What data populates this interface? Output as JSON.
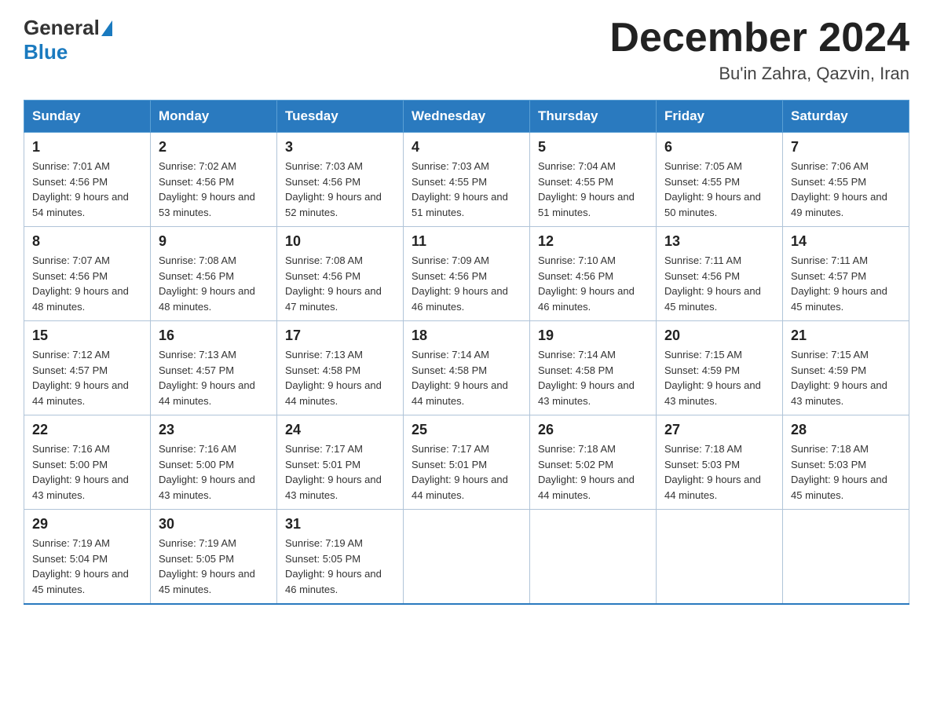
{
  "header": {
    "logo_general": "General",
    "logo_blue": "Blue",
    "month_title": "December 2024",
    "location": "Bu'in Zahra, Qazvin, Iran"
  },
  "days_of_week": [
    "Sunday",
    "Monday",
    "Tuesday",
    "Wednesday",
    "Thursday",
    "Friday",
    "Saturday"
  ],
  "weeks": [
    [
      {
        "day": 1,
        "sunrise": "7:01 AM",
        "sunset": "4:56 PM",
        "daylight": "9 hours and 54 minutes."
      },
      {
        "day": 2,
        "sunrise": "7:02 AM",
        "sunset": "4:56 PM",
        "daylight": "9 hours and 53 minutes."
      },
      {
        "day": 3,
        "sunrise": "7:03 AM",
        "sunset": "4:56 PM",
        "daylight": "9 hours and 52 minutes."
      },
      {
        "day": 4,
        "sunrise": "7:03 AM",
        "sunset": "4:55 PM",
        "daylight": "9 hours and 51 minutes."
      },
      {
        "day": 5,
        "sunrise": "7:04 AM",
        "sunset": "4:55 PM",
        "daylight": "9 hours and 51 minutes."
      },
      {
        "day": 6,
        "sunrise": "7:05 AM",
        "sunset": "4:55 PM",
        "daylight": "9 hours and 50 minutes."
      },
      {
        "day": 7,
        "sunrise": "7:06 AM",
        "sunset": "4:55 PM",
        "daylight": "9 hours and 49 minutes."
      }
    ],
    [
      {
        "day": 8,
        "sunrise": "7:07 AM",
        "sunset": "4:56 PM",
        "daylight": "9 hours and 48 minutes."
      },
      {
        "day": 9,
        "sunrise": "7:08 AM",
        "sunset": "4:56 PM",
        "daylight": "9 hours and 48 minutes."
      },
      {
        "day": 10,
        "sunrise": "7:08 AM",
        "sunset": "4:56 PM",
        "daylight": "9 hours and 47 minutes."
      },
      {
        "day": 11,
        "sunrise": "7:09 AM",
        "sunset": "4:56 PM",
        "daylight": "9 hours and 46 minutes."
      },
      {
        "day": 12,
        "sunrise": "7:10 AM",
        "sunset": "4:56 PM",
        "daylight": "9 hours and 46 minutes."
      },
      {
        "day": 13,
        "sunrise": "7:11 AM",
        "sunset": "4:56 PM",
        "daylight": "9 hours and 45 minutes."
      },
      {
        "day": 14,
        "sunrise": "7:11 AM",
        "sunset": "4:57 PM",
        "daylight": "9 hours and 45 minutes."
      }
    ],
    [
      {
        "day": 15,
        "sunrise": "7:12 AM",
        "sunset": "4:57 PM",
        "daylight": "9 hours and 44 minutes."
      },
      {
        "day": 16,
        "sunrise": "7:13 AM",
        "sunset": "4:57 PM",
        "daylight": "9 hours and 44 minutes."
      },
      {
        "day": 17,
        "sunrise": "7:13 AM",
        "sunset": "4:58 PM",
        "daylight": "9 hours and 44 minutes."
      },
      {
        "day": 18,
        "sunrise": "7:14 AM",
        "sunset": "4:58 PM",
        "daylight": "9 hours and 44 minutes."
      },
      {
        "day": 19,
        "sunrise": "7:14 AM",
        "sunset": "4:58 PM",
        "daylight": "9 hours and 43 minutes."
      },
      {
        "day": 20,
        "sunrise": "7:15 AM",
        "sunset": "4:59 PM",
        "daylight": "9 hours and 43 minutes."
      },
      {
        "day": 21,
        "sunrise": "7:15 AM",
        "sunset": "4:59 PM",
        "daylight": "9 hours and 43 minutes."
      }
    ],
    [
      {
        "day": 22,
        "sunrise": "7:16 AM",
        "sunset": "5:00 PM",
        "daylight": "9 hours and 43 minutes."
      },
      {
        "day": 23,
        "sunrise": "7:16 AM",
        "sunset": "5:00 PM",
        "daylight": "9 hours and 43 minutes."
      },
      {
        "day": 24,
        "sunrise": "7:17 AM",
        "sunset": "5:01 PM",
        "daylight": "9 hours and 43 minutes."
      },
      {
        "day": 25,
        "sunrise": "7:17 AM",
        "sunset": "5:01 PM",
        "daylight": "9 hours and 44 minutes."
      },
      {
        "day": 26,
        "sunrise": "7:18 AM",
        "sunset": "5:02 PM",
        "daylight": "9 hours and 44 minutes."
      },
      {
        "day": 27,
        "sunrise": "7:18 AM",
        "sunset": "5:03 PM",
        "daylight": "9 hours and 44 minutes."
      },
      {
        "day": 28,
        "sunrise": "7:18 AM",
        "sunset": "5:03 PM",
        "daylight": "9 hours and 45 minutes."
      }
    ],
    [
      {
        "day": 29,
        "sunrise": "7:19 AM",
        "sunset": "5:04 PM",
        "daylight": "9 hours and 45 minutes."
      },
      {
        "day": 30,
        "sunrise": "7:19 AM",
        "sunset": "5:05 PM",
        "daylight": "9 hours and 45 minutes."
      },
      {
        "day": 31,
        "sunrise": "7:19 AM",
        "sunset": "5:05 PM",
        "daylight": "9 hours and 46 minutes."
      },
      null,
      null,
      null,
      null
    ]
  ]
}
